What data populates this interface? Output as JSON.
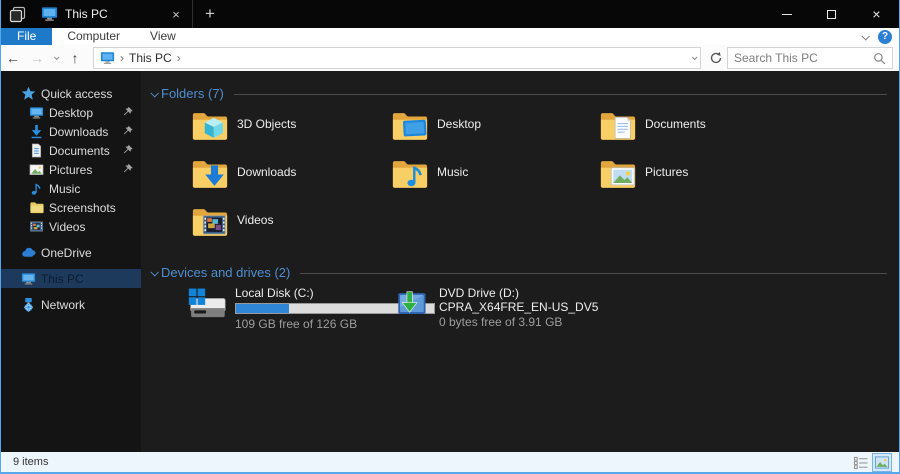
{
  "colors": {
    "accent_blue": "#1e7ac9",
    "window_border": "#54a7ea",
    "selection_bg": "#1d3a5c",
    "section_header_blue": "#4f8fd0",
    "folder_yellow": "#f7cf64",
    "disk_bar_fill": "#2f86d7",
    "disk_bar_track": "#dcdcdc"
  },
  "titlebar": {
    "tab": {
      "title": "This PC",
      "icon": "monitor"
    },
    "left_icon": "sets-stack",
    "tab_close": "×",
    "new_tab": "+",
    "window_controls": {
      "minimize": "minimize",
      "maximize": "maximize",
      "close": "×"
    }
  },
  "menubar": {
    "items": [
      {
        "label": "File",
        "active": true
      },
      {
        "label": "Computer",
        "active": false
      },
      {
        "label": "View",
        "active": false
      }
    ],
    "help_icon": "?"
  },
  "navbar": {
    "back": "←",
    "forward": "→",
    "up": "↑",
    "address": {
      "root_icon": "monitor",
      "path": "This PC",
      "separator": "›"
    },
    "search": {
      "placeholder": "Search This PC",
      "icon": "magnifier"
    }
  },
  "sidebar": {
    "items": [
      {
        "label": "Quick access",
        "icon": "star",
        "level": 0,
        "pinned": false,
        "selected": false,
        "gap": false
      },
      {
        "label": "Desktop",
        "icon": "desktop",
        "level": 1,
        "pinned": true,
        "selected": false,
        "gap": false
      },
      {
        "label": "Downloads",
        "icon": "download",
        "level": 1,
        "pinned": true,
        "selected": false,
        "gap": false
      },
      {
        "label": "Documents",
        "icon": "document",
        "level": 1,
        "pinned": true,
        "selected": false,
        "gap": false
      },
      {
        "label": "Pictures",
        "icon": "picture",
        "level": 1,
        "pinned": true,
        "selected": false,
        "gap": false
      },
      {
        "label": "Music",
        "icon": "music",
        "level": 1,
        "pinned": false,
        "selected": false,
        "gap": false
      },
      {
        "label": "Screenshots",
        "icon": "screenshots",
        "level": 1,
        "pinned": false,
        "selected": false,
        "gap": false
      },
      {
        "label": "Videos",
        "icon": "videos",
        "level": 1,
        "pinned": false,
        "selected": false,
        "gap": false
      },
      {
        "label": "OneDrive",
        "icon": "onedrive",
        "level": 0,
        "pinned": false,
        "selected": false,
        "gap": true
      },
      {
        "label": "This PC",
        "icon": "thispc",
        "level": 0,
        "pinned": false,
        "selected": true,
        "gap": true
      },
      {
        "label": "Network",
        "icon": "network",
        "level": 0,
        "pinned": false,
        "selected": false,
        "gap": true
      }
    ]
  },
  "content": {
    "sections": {
      "folders": {
        "title": "Folders (7)"
      },
      "devices": {
        "title": "Devices and drives (2)"
      }
    },
    "folders": [
      {
        "name": "3D Objects",
        "icon": "folder-3d"
      },
      {
        "name": "Desktop",
        "icon": "folder-desktop"
      },
      {
        "name": "Documents",
        "icon": "folder-documents"
      },
      {
        "name": "Downloads",
        "icon": "folder-downloads"
      },
      {
        "name": "Music",
        "icon": "folder-music"
      },
      {
        "name": "Pictures",
        "icon": "folder-pictures"
      },
      {
        "name": "Videos",
        "icon": "folder-videos"
      }
    ],
    "drives": [
      {
        "name": "Local Disk (C:)",
        "icon": "drive-hdd",
        "volume_label": "",
        "free_text": "109 GB free of 126 GB",
        "has_bar": true,
        "used_percent": 27
      },
      {
        "name": "DVD Drive (D:)",
        "icon": "drive-dvd",
        "volume_label": "CPRA_X64FRE_EN-US_DV5",
        "free_text": "0 bytes free of 3.91 GB",
        "has_bar": false,
        "used_percent": 0
      }
    ]
  },
  "statusbar": {
    "items_count": "9 items",
    "view_icons": [
      {
        "icon": "details-view",
        "active": false
      },
      {
        "icon": "thumbnail-view",
        "active": true
      }
    ]
  }
}
